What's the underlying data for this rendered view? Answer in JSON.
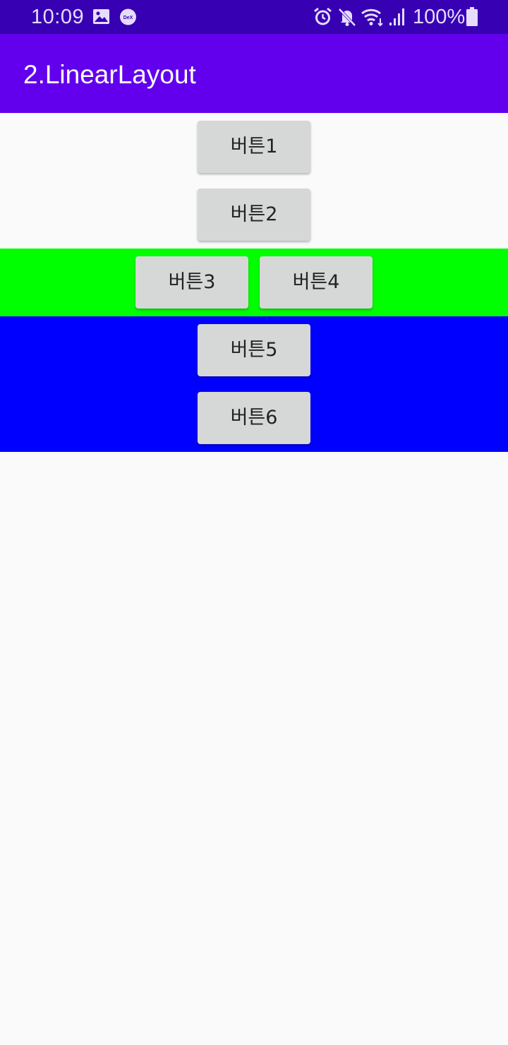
{
  "status_bar": {
    "time": "10:09",
    "left_icons": [
      "image-icon",
      "dex-icon"
    ],
    "dex_label": "DeX",
    "right_icons": [
      "alarm-icon",
      "mute-icon",
      "wifi-icon",
      "signal-icon",
      "battery-icon"
    ],
    "battery": "100%",
    "background_color": "#3700b3"
  },
  "app_bar": {
    "title": "2.LinearLayout",
    "background_color": "#6200ee"
  },
  "layout": {
    "top_group": {
      "background_color": "#fafafa",
      "buttons": [
        "버튼1",
        "버튼2"
      ]
    },
    "green_group": {
      "background_color": "#00ff00",
      "buttons": [
        "버튼3",
        "버튼4"
      ]
    },
    "blue_group": {
      "background_color": "#0000ff",
      "buttons": [
        "버튼5",
        "버튼6"
      ]
    }
  }
}
